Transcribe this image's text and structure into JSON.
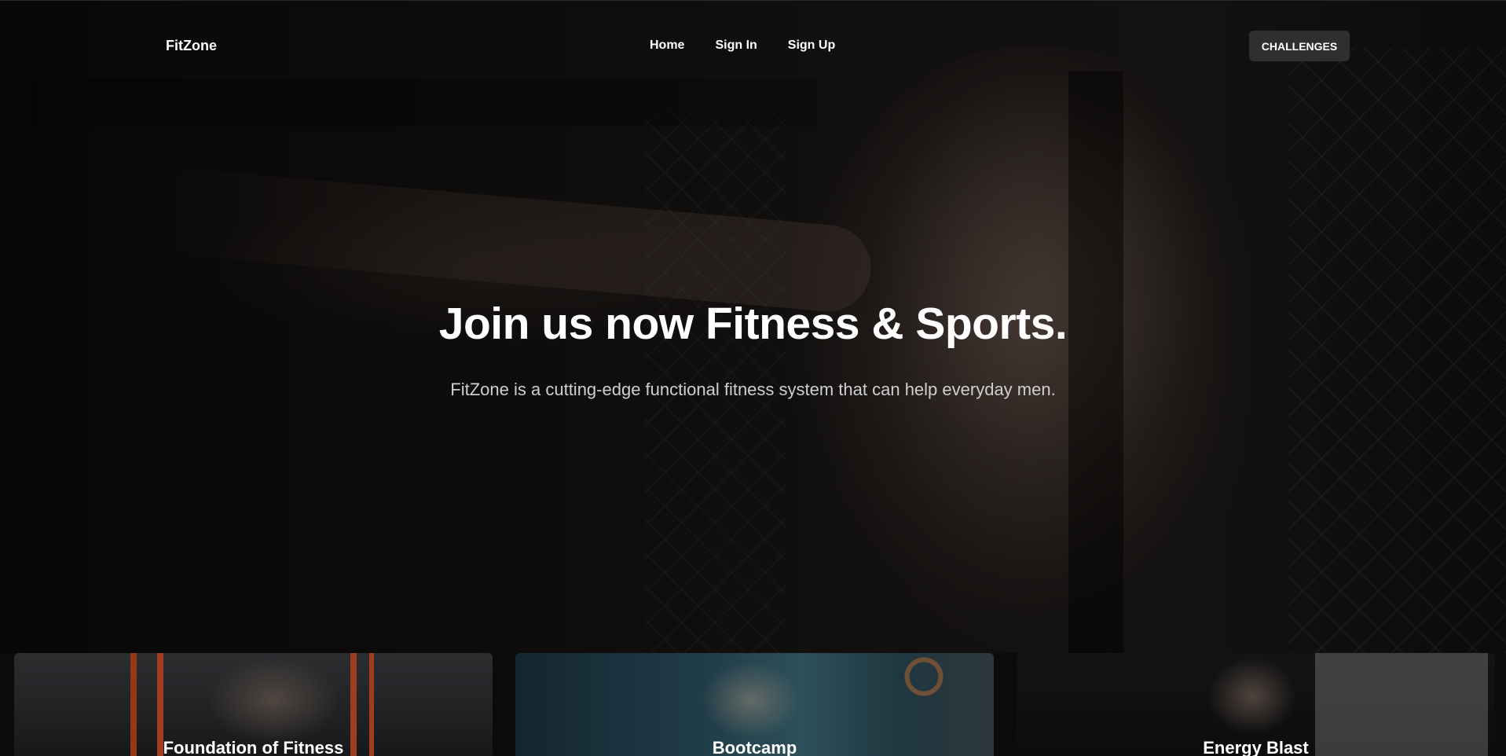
{
  "navbar": {
    "brand": "FitZone",
    "links": [
      {
        "label": "Home"
      },
      {
        "label": "Sign In"
      },
      {
        "label": "Sign Up"
      }
    ],
    "cta_label": "CHALLENGES"
  },
  "hero": {
    "title": "Join us now Fitness & Sports.",
    "subtitle": "FitZone is a cutting-edge functional fitness system that can help everyday men."
  },
  "programs": [
    {
      "title": "Foundation of Fitness"
    },
    {
      "title": "Bootcamp"
    },
    {
      "title": "Energy Blast"
    }
  ],
  "colors": {
    "background": "#0b0b0b",
    "cta_background": "#2f2f2f",
    "text": "#ffffff",
    "subtitle_text": "#cfcfcf"
  }
}
